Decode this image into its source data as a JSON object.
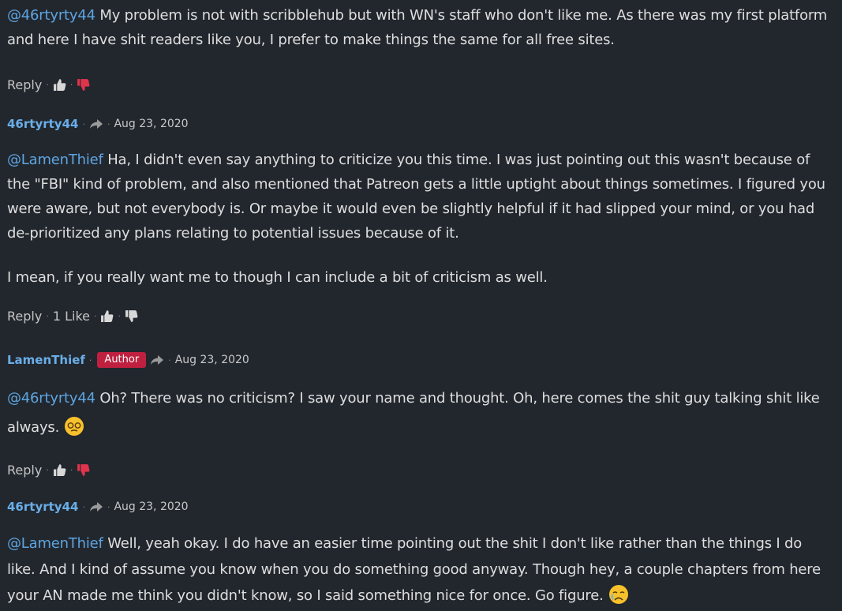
{
  "comments": [
    {
      "mention": "@46rtyrty44",
      "text": " My problem is not with scribblehub but with WN's staff who don't like me. As there was my first platform and here I have shit readers like you, I prefer to make things the same for all free sites.",
      "reply_label": "Reply",
      "thumb_down_color": "#e0344c"
    },
    {
      "author": "46rtyrty44",
      "date": "Aug 23, 2020",
      "mention": "@LamenThief",
      "text": " Ha, I didn't even say anything to criticize you this time. I was just pointing out this wasn't because of the \"FBI\" kind of problem, and also mentioned that Patreon gets a little uptight about things sometimes. I figured you were aware, but not everybody is. Or maybe it would even be slightly helpful if it had slipped your mind, or you had de-prioritized any plans relating to potential issues because of it.",
      "text2": "I mean, if you really want me to though I can include a bit of criticism as well.",
      "reply_label": "Reply",
      "likes": "1 Like"
    },
    {
      "author": "LamenThief",
      "badge": "Author",
      "date": "Aug 23, 2020",
      "mention": "@46rtyrty44",
      "text": " Oh? There was no criticism? I saw your name and thought. Oh, here comes the shit guy talking shit like always.",
      "emoji": "face-with-spiral-eyes-emoji",
      "reply_label": "Reply"
    },
    {
      "author": "46rtyrty44",
      "date": "Aug 23, 2020",
      "mention": "@LamenThief",
      "text": " Well, yeah okay. I do have an easier time pointing out the shit I don't like rather than the things I do like. And I kind of assume you know when you do something good anyway. Though hey, a couple chapters from here your AN made me think you didn't know, so I said something nice for once. Go figure.",
      "emoji": "crying-face-emoji"
    }
  ],
  "icons": {
    "reply": "share-arrow-icon",
    "like": "thumbs-up-icon",
    "dislike": "thumbs-down-icon"
  },
  "colors": {
    "background": "#22272e",
    "mention": "#5ea4e0",
    "author_badge": "#c0203f"
  }
}
